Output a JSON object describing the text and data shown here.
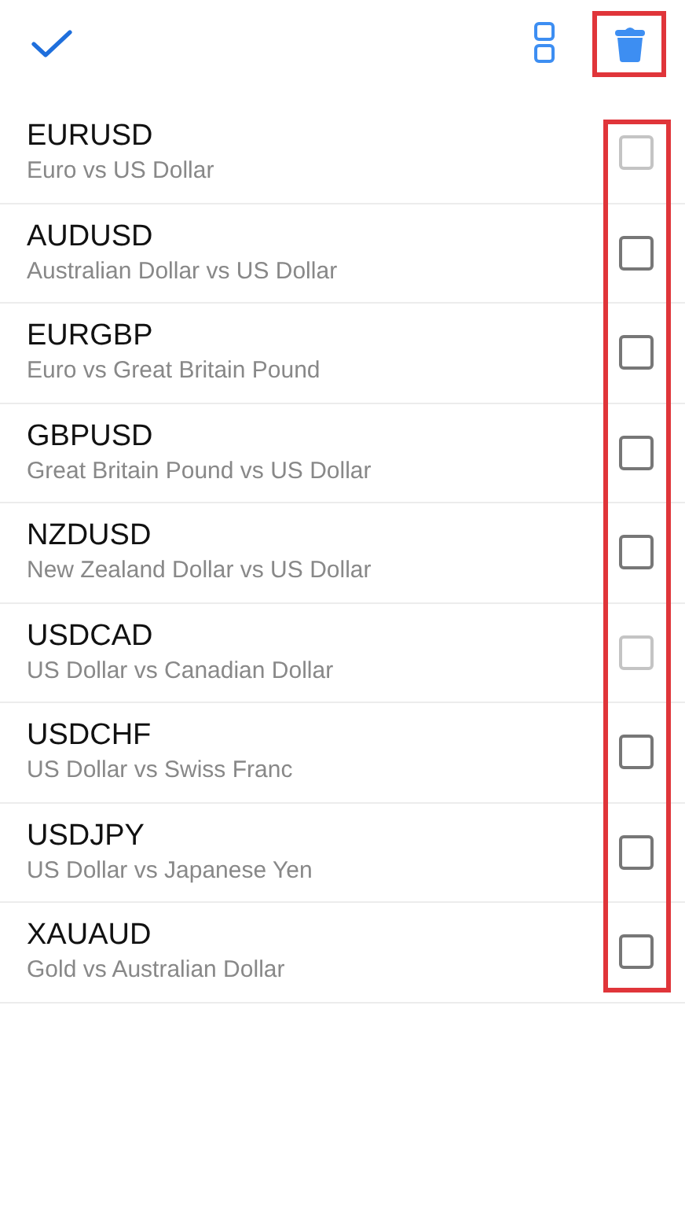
{
  "toolbar": {
    "delete_highlighted": true
  },
  "symbols_highlighted": true,
  "symbols": [
    {
      "symbol": "EURUSD",
      "description": "Euro vs US Dollar",
      "disabled": true,
      "checked": false
    },
    {
      "symbol": "AUDUSD",
      "description": "Australian Dollar vs US Dollar",
      "disabled": false,
      "checked": false
    },
    {
      "symbol": "EURGBP",
      "description": "Euro vs Great Britain Pound",
      "disabled": false,
      "checked": false
    },
    {
      "symbol": "GBPUSD",
      "description": "Great Britain Pound vs US Dollar",
      "disabled": false,
      "checked": false
    },
    {
      "symbol": "NZDUSD",
      "description": "New Zealand Dollar vs US Dollar",
      "disabled": false,
      "checked": false
    },
    {
      "symbol": "USDCAD",
      "description": "US Dollar vs Canadian Dollar",
      "disabled": true,
      "checked": false
    },
    {
      "symbol": "USDCHF",
      "description": "US Dollar vs Swiss Franc",
      "disabled": false,
      "checked": false
    },
    {
      "symbol": "USDJPY",
      "description": "US Dollar vs Japanese Yen",
      "disabled": false,
      "checked": false
    },
    {
      "symbol": "XAUAUD",
      "description": "Gold vs Australian Dollar",
      "disabled": false,
      "checked": false
    }
  ]
}
